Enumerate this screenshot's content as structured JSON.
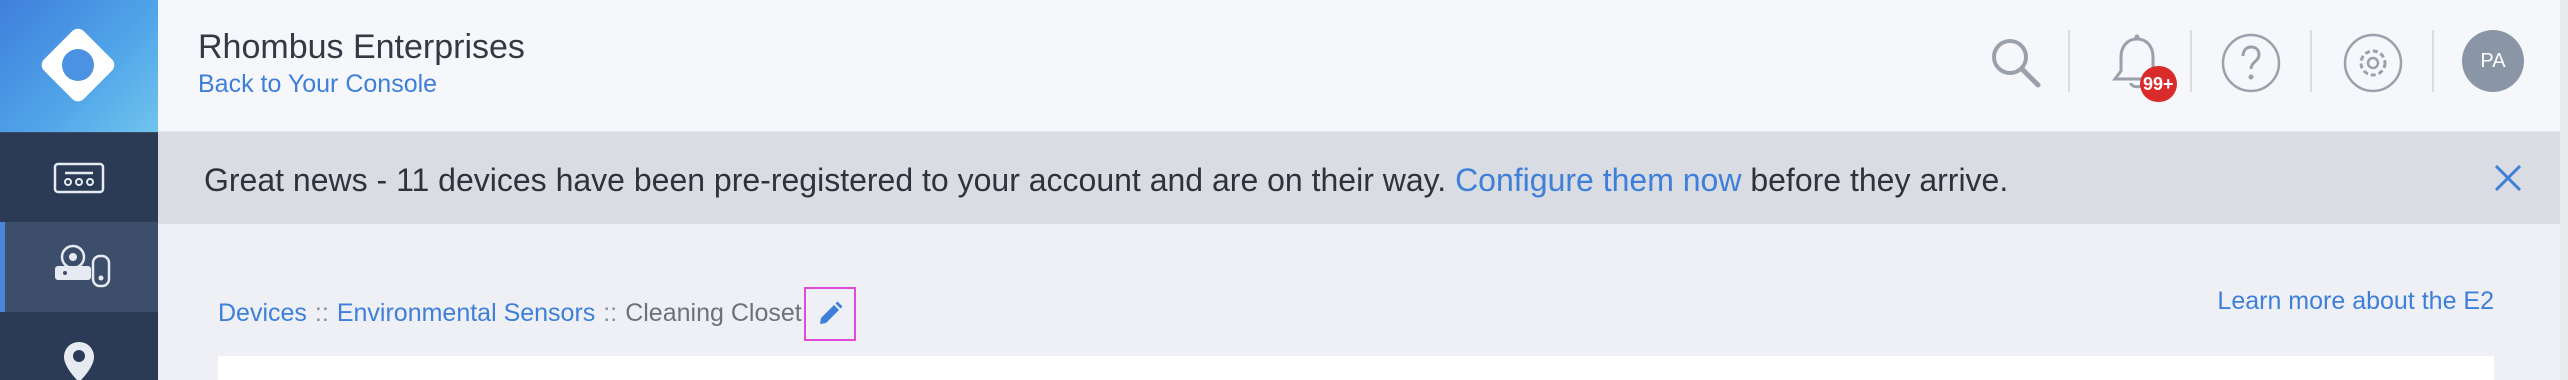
{
  "sidebar": {
    "logo": "rhombus-logo",
    "items": [
      {
        "name": "devices-icon"
      },
      {
        "name": "cameras-sensors-icon"
      },
      {
        "name": "map-pin-icon"
      }
    ]
  },
  "header": {
    "org_name": "Rhombus Enterprises",
    "back_link": "Back to Your Console",
    "notifications_badge": "99+",
    "avatar_initials": "PA"
  },
  "banner": {
    "text_before": "Great news - 11 devices have been pre-registered to your account and are on their way. ",
    "link": "Configure them now",
    "text_after": " before they arrive."
  },
  "breadcrumb": {
    "items": [
      "Devices",
      "Environmental Sensors",
      "Cleaning Closet"
    ],
    "separator": "::"
  },
  "learn_more": "Learn more about the E2",
  "colors": {
    "sidebar": "#2b3a55",
    "accent": "#3d7fd9",
    "badge": "#d92b2b",
    "banner": "#d9dde3"
  }
}
